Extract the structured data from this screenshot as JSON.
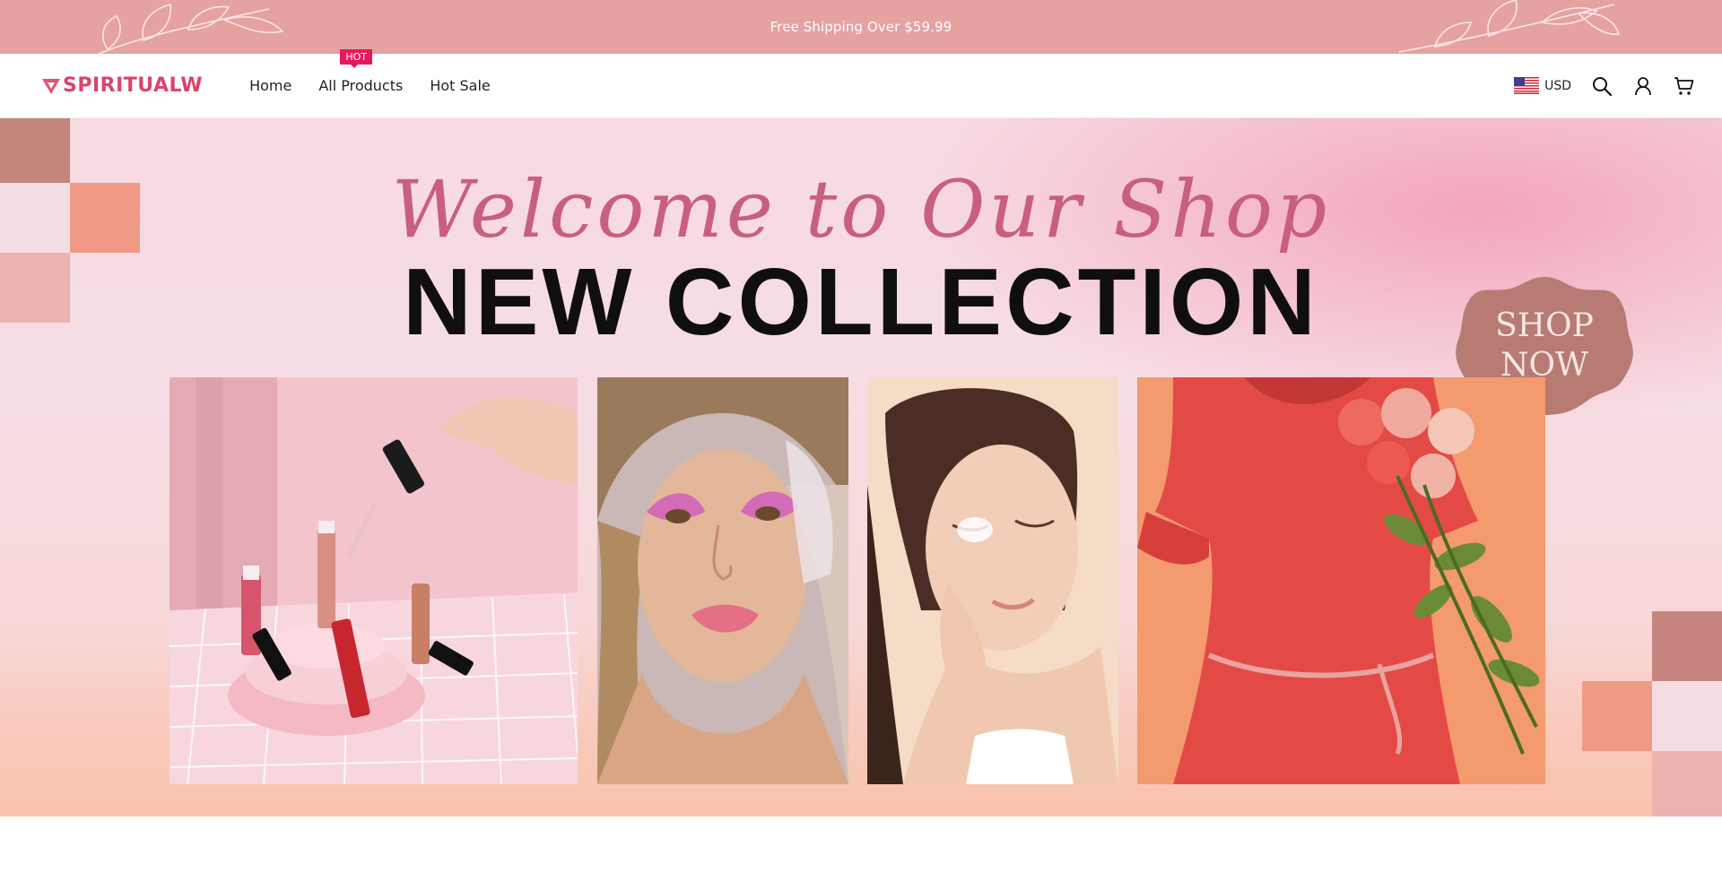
{
  "announcement": {
    "text": "Free Shipping Over $59.99"
  },
  "header": {
    "logo_text": "SPIRITUALW",
    "nav": [
      {
        "label": "Home"
      },
      {
        "label": "All Products",
        "badge": "HOT"
      },
      {
        "label": "Hot Sale"
      }
    ],
    "currency": "USD",
    "icons": [
      "us-flag-icon",
      "search-icon",
      "account-icon",
      "cart-icon"
    ]
  },
  "hero": {
    "script_title": "Welcome to Our Shop",
    "title": "NEW COLLECTION",
    "cta": {
      "line1": "SHOP",
      "line2": "NOW"
    },
    "images": [
      "lip-gloss-photo",
      "glam-makeup-photo",
      "skincare-photo",
      "red-dress-photo"
    ]
  },
  "colors": {
    "announce_bg": "#e5a2a0",
    "brand": "#d9456a",
    "hot_badge": "#e4195c",
    "script": "#c95f80",
    "cta_bg": "#b87b74"
  }
}
